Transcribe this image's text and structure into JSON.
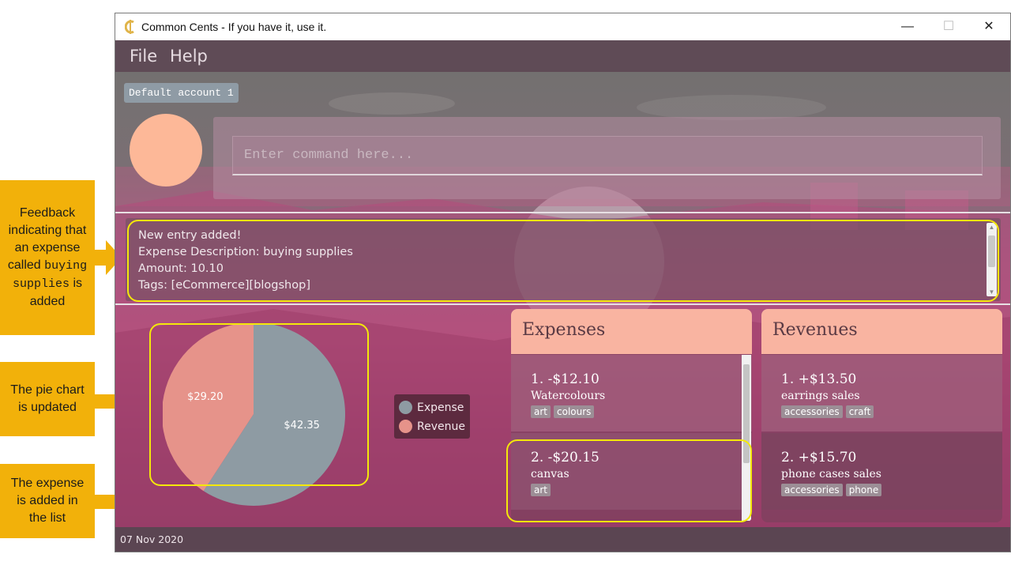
{
  "window": {
    "title": "Common Cents - If you have it, use it.",
    "controls": {
      "minimize": "—",
      "maximize": "☐",
      "close": "✕"
    }
  },
  "menu": {
    "file": "File",
    "help": "Help"
  },
  "account": {
    "name": "Default account 1"
  },
  "command": {
    "placeholder": "Enter command here..."
  },
  "result": {
    "lines": [
      "New entry added!",
      "Expense Description: buying supplies",
      "Amount: 10.10",
      "Tags: [eCommerce][blogshop]"
    ]
  },
  "chart_data": {
    "type": "pie",
    "slices": [
      {
        "label": "Expense",
        "value": 42.35,
        "display": "$42.35",
        "color": "#8e9ba3"
      },
      {
        "label": "Revenue",
        "value": 29.2,
        "display": "$29.20",
        "color": "#e6938a"
      }
    ],
    "legend": [
      "Expense",
      "Revenue"
    ]
  },
  "expenses": {
    "header": "Expenses",
    "items": [
      {
        "title": "1.  -$12.10",
        "desc": "Watercolours",
        "tags": [
          "art",
          "colours"
        ]
      },
      {
        "title": "2.  -$20.15",
        "desc": "canvas",
        "tags": [
          "art"
        ]
      }
    ]
  },
  "revenues": {
    "header": "Revenues",
    "items": [
      {
        "title": "1.  +$13.50",
        "desc": "earrings sales",
        "tags": [
          "accessories",
          "craft"
        ]
      },
      {
        "title": "2.  +$15.70",
        "desc": "phone cases sales",
        "tags": [
          "accessories",
          "phone"
        ]
      }
    ]
  },
  "status": {
    "date": "07 Nov 2020"
  },
  "annotations": {
    "feedback": {
      "before": "Feedback indicating that an expense called",
      "code": "buying supplies",
      "after": "is added"
    },
    "pie": "The pie chart is updated",
    "list": "The expense is added in the list"
  },
  "colors": {
    "accent": "#f9b4a1",
    "annotation": "#f2b10a",
    "highlight": "#f4e80a"
  }
}
